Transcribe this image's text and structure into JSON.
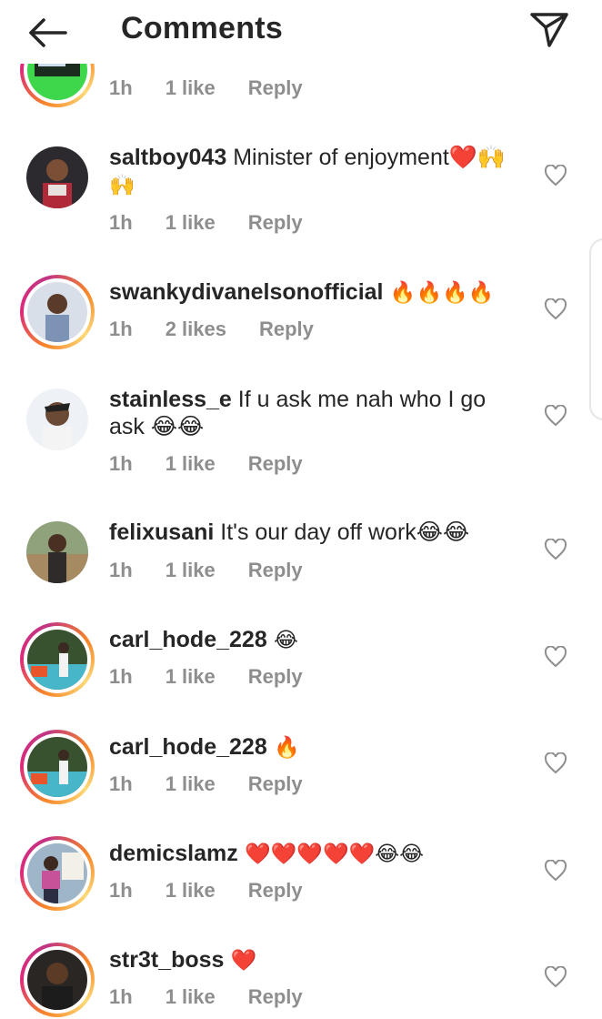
{
  "header": {
    "title": "Comments",
    "back_icon": "arrow-left-icon",
    "send_icon": "paper-plane-icon"
  },
  "partial_top": {
    "time": "1h",
    "likes": "1 like",
    "reply": "Reply"
  },
  "comments": [
    {
      "username": "saltboy043",
      "text": " Minister of enjoyment❤️🙌",
      "text2": "🙌",
      "time": "1h",
      "likes": "1 like",
      "reply": "Reply"
    },
    {
      "username": "swankydivanelsonofficial",
      "text": " 🔥🔥🔥🔥",
      "time": "1h",
      "likes": "2 likes",
      "reply": "Reply"
    },
    {
      "username": "stainless_e",
      "text": " If u ask me nah who I go",
      "text2": "ask 😂😂",
      "time": "1h",
      "likes": "1 like",
      "reply": "Reply"
    },
    {
      "username": "felixusani",
      "text": " It's our day off work😂😂",
      "time": "1h",
      "likes": "1 like",
      "reply": "Reply"
    },
    {
      "username": "carl_hode_228",
      "text": " 😂",
      "time": "1h",
      "likes": "1 like",
      "reply": "Reply"
    },
    {
      "username": "carl_hode_228",
      "text": " 🔥",
      "time": "1h",
      "likes": "1 like",
      "reply": "Reply"
    },
    {
      "username": "demicslamz",
      "text": " ❤️❤️❤️❤️❤️😂😂",
      "time": "1h",
      "likes": "1 like",
      "reply": "Reply"
    },
    {
      "username": "str3t_boss",
      "text": " ❤️",
      "time": "1h",
      "likes": "1 like",
      "reply": "Reply"
    }
  ],
  "colors": {
    "text": "#262626",
    "meta": "#8e8e8e",
    "heart": "#8e8e8e"
  }
}
